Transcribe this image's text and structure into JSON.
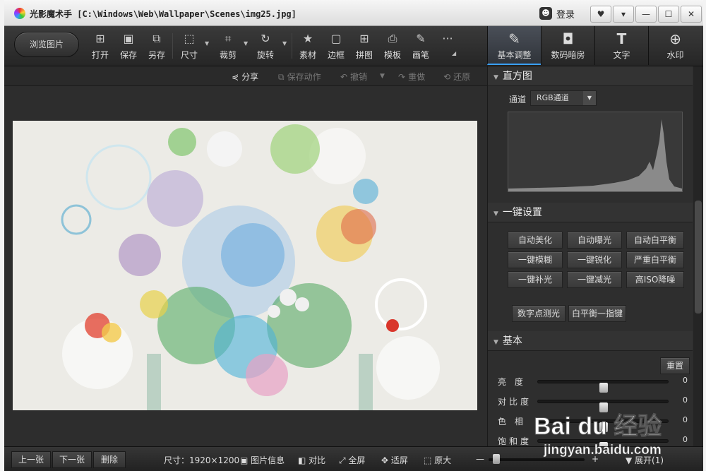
{
  "window": {
    "title": "光影魔术手 [C:\\Windows\\Web\\Wallpaper\\Scenes\\img25.jpg]",
    "login_label": "登录",
    "controls": [
      "♥",
      "▾",
      "—",
      "☐",
      "✕"
    ]
  },
  "toolbar": {
    "browse_label": "浏览图片",
    "tools": [
      {
        "label": "打开",
        "icon": "open-icon",
        "glyph": "⊞"
      },
      {
        "label": "保存",
        "icon": "save-icon",
        "glyph": "▣"
      },
      {
        "label": "另存",
        "icon": "save-as-icon",
        "glyph": "⧉"
      },
      {
        "label": "尺寸",
        "icon": "resize-icon",
        "glyph": "⬚"
      },
      {
        "label": "裁剪",
        "icon": "crop-icon",
        "glyph": "⌗"
      },
      {
        "label": "旋转",
        "icon": "rotate-icon",
        "glyph": "↻"
      },
      {
        "label": "素材",
        "icon": "material-icon",
        "glyph": "★"
      },
      {
        "label": "边框",
        "icon": "border-icon",
        "glyph": "▢"
      },
      {
        "label": "拼图",
        "icon": "collage-icon",
        "glyph": "⊞"
      },
      {
        "label": "模板",
        "icon": "template-icon",
        "glyph": "⎙"
      },
      {
        "label": "画笔",
        "icon": "brush-icon",
        "glyph": "✎"
      },
      {
        "label": "",
        "icon": "more-icon",
        "glyph": "···"
      }
    ],
    "right_tabs": [
      {
        "label": "基本调整",
        "icon": "adjust-icon",
        "glyph": "✎",
        "active": true
      },
      {
        "label": "数码暗房",
        "icon": "darkroom-icon",
        "glyph": "◘",
        "active": false
      },
      {
        "label": "文字",
        "icon": "text-icon",
        "glyph": "T",
        "active": false
      },
      {
        "label": "水印",
        "icon": "watermark-icon",
        "glyph": "⊕",
        "active": false
      }
    ]
  },
  "actions": {
    "share": "分享",
    "save_action": "保存动作",
    "undo": "撤销",
    "redo": "重做",
    "restore": "还原"
  },
  "panel": {
    "histogram": {
      "title": "直方图",
      "channel_label": "通道",
      "channel_value": "RGB通道"
    },
    "oneclick": {
      "title": "一键设置",
      "buttons": [
        "自动美化",
        "自动曝光",
        "自动白平衡",
        "一键模糊",
        "一键锐化",
        "严重白平衡",
        "一键补光",
        "一键减光",
        "高ISO降噪"
      ],
      "extra_buttons": [
        "数字点测光",
        "白平衡一指键"
      ]
    },
    "basic": {
      "title": "基本",
      "reset": "重置",
      "sliders": [
        {
          "label": "亮 度",
          "value": "0",
          "level": 0.5
        },
        {
          "label": "对比度",
          "value": "0",
          "level": 0.5
        },
        {
          "label": "色 相",
          "value": "0",
          "level": 0.5
        },
        {
          "label": "饱和度",
          "value": "0",
          "level": 0.5
        }
      ]
    }
  },
  "status": {
    "prev": "上一张",
    "next": "下一张",
    "delete": "删除",
    "size": "尺寸：1920×1200",
    "info": "图片信息",
    "compare": "对比",
    "fullscreen": "全屏",
    "fit": "适屏",
    "original": "原大",
    "minus": "—",
    "plus": "+",
    "expand": "展开(1)"
  },
  "watermark": {
    "brand": "Bai du 经验",
    "url": "jingyan.baidu.com"
  },
  "colors": {
    "accent": "#3aa0ff",
    "panel_bg": "#2e2e2e",
    "toolbar_bg": "#2b2b2b"
  }
}
